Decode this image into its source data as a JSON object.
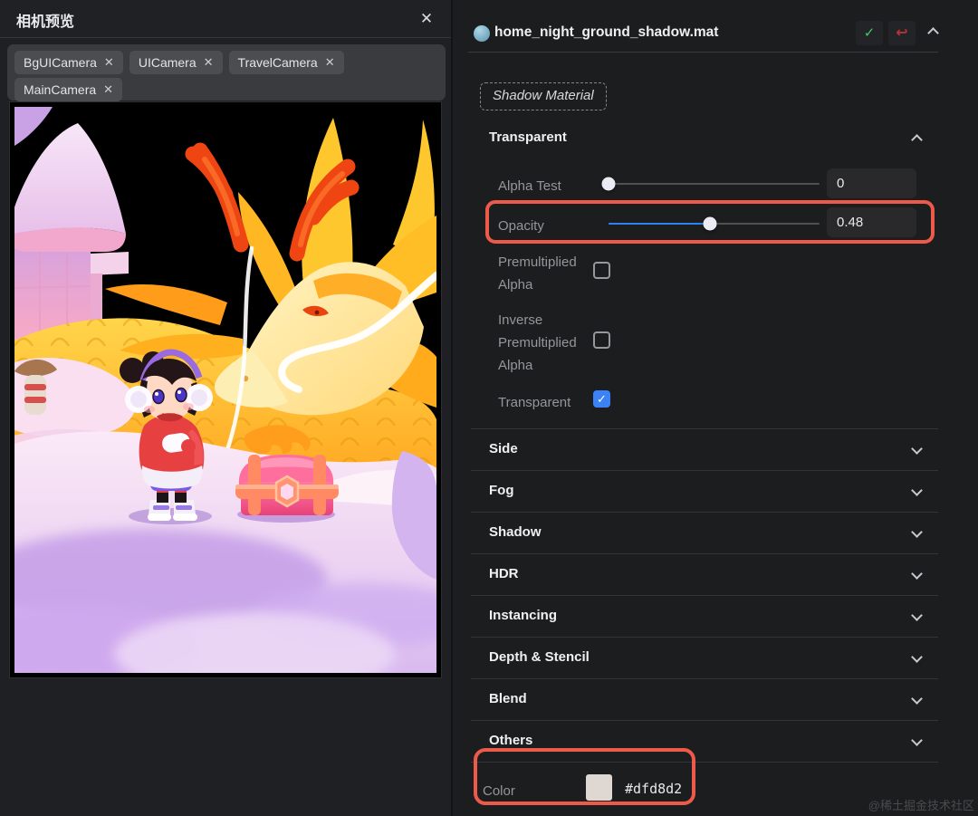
{
  "left_panel": {
    "title": "相机预览",
    "camera_filter": {
      "tags": [
        "BgUICamera",
        "UICamera",
        "TravelCamera",
        "MainCamera"
      ]
    }
  },
  "inspector": {
    "material_name": "home_night_ground_shadow.mat",
    "material_tag": "Shadow Material",
    "transparent": {
      "title": "Transparent",
      "alpha_test": {
        "label": "Alpha Test",
        "value": "0",
        "fraction": 0
      },
      "opacity": {
        "label": "Opacity",
        "value": "0.48",
        "fraction": 0.48
      },
      "premultiplied_alpha": {
        "label": "Premultiplied Alpha",
        "checked": false
      },
      "inverse_premultiplied_alpha": {
        "label": "Inverse Premultiplied Alpha",
        "checked": false
      },
      "transparent_flag": {
        "label": "Transparent",
        "checked": true
      }
    },
    "collapsed_sections": [
      "Side",
      "Fog",
      "Shadow",
      "HDR",
      "Instancing",
      "Depth & Stencil",
      "Blend",
      "Others"
    ],
    "others": {
      "color_label": "Color",
      "color_hex": "#dfd8d2",
      "swatch_color": "#dfd8d2"
    }
  },
  "icons": {
    "close": "✕",
    "remove_tag": "✕",
    "check": "✓",
    "revert": "↩"
  },
  "colors": {
    "accent_blue": "#2f80f0",
    "annotation_red": "#ee5a49",
    "checkbox_checked": "#3b82f6",
    "swatch": "#dfd8d2"
  },
  "watermark": "@稀土掘金技术社区"
}
